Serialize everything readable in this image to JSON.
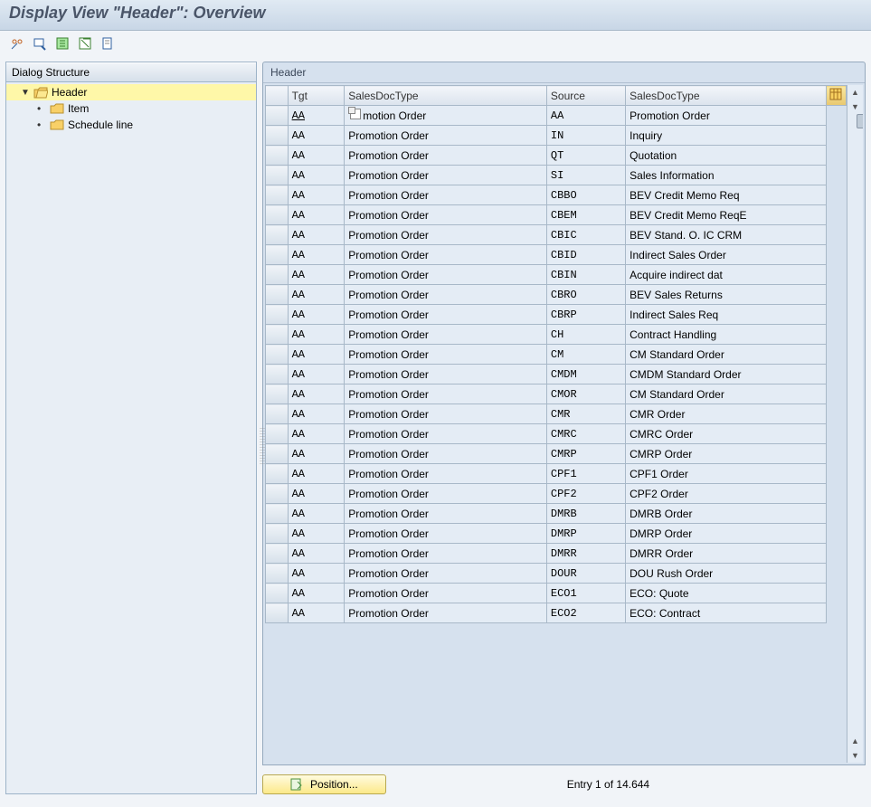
{
  "title": "Display View \"Header\": Overview",
  "toolbar_icons": [
    "glasses",
    "find",
    "table-nav",
    "table-export",
    "document"
  ],
  "tree": {
    "header": "Dialog Structure",
    "items": [
      {
        "label": "Header",
        "selected": true,
        "open": true,
        "level": 1,
        "expander": "▼"
      },
      {
        "label": "Item",
        "selected": false,
        "open": false,
        "level": 2,
        "expander": "•"
      },
      {
        "label": "Schedule line",
        "selected": false,
        "open": false,
        "level": 2,
        "expander": "•"
      }
    ]
  },
  "grid": {
    "title": "Header",
    "columns": [
      "Tgt",
      "SalesDocType",
      "Source",
      "SalesDocType"
    ],
    "rows": [
      {
        "tgt": "AA",
        "t1": "Promotion Order",
        "src": "AA",
        "t2": "Promotion Order",
        "f4": true
      },
      {
        "tgt": "AA",
        "t1": "Promotion Order",
        "src": "IN",
        "t2": "Inquiry"
      },
      {
        "tgt": "AA",
        "t1": "Promotion Order",
        "src": "QT",
        "t2": "Quotation"
      },
      {
        "tgt": "AA",
        "t1": "Promotion Order",
        "src": "SI",
        "t2": "Sales Information"
      },
      {
        "tgt": "AA",
        "t1": "Promotion Order",
        "src": "CBBO",
        "t2": "BEV Credit Memo Req"
      },
      {
        "tgt": "AA",
        "t1": "Promotion Order",
        "src": "CBEM",
        "t2": "BEV Credit Memo ReqE"
      },
      {
        "tgt": "AA",
        "t1": "Promotion Order",
        "src": "CBIC",
        "t2": "BEV Stand. O. IC CRM"
      },
      {
        "tgt": "AA",
        "t1": "Promotion Order",
        "src": "CBID",
        "t2": "Indirect Sales Order"
      },
      {
        "tgt": "AA",
        "t1": "Promotion Order",
        "src": "CBIN",
        "t2": "Acquire indirect dat"
      },
      {
        "tgt": "AA",
        "t1": "Promotion Order",
        "src": "CBRO",
        "t2": "BEV Sales Returns"
      },
      {
        "tgt": "AA",
        "t1": "Promotion Order",
        "src": "CBRP",
        "t2": "Indirect Sales Req"
      },
      {
        "tgt": "AA",
        "t1": "Promotion Order",
        "src": "CH",
        "t2": "Contract Handling"
      },
      {
        "tgt": "AA",
        "t1": "Promotion Order",
        "src": "CM",
        "t2": "CM Standard Order"
      },
      {
        "tgt": "AA",
        "t1": "Promotion Order",
        "src": "CMDM",
        "t2": "CMDM Standard Order"
      },
      {
        "tgt": "AA",
        "t1": "Promotion Order",
        "src": "CMOR",
        "t2": "CM Standard Order"
      },
      {
        "tgt": "AA",
        "t1": "Promotion Order",
        "src": "CMR",
        "t2": "CMR Order"
      },
      {
        "tgt": "AA",
        "t1": "Promotion Order",
        "src": "CMRC",
        "t2": "CMRC Order"
      },
      {
        "tgt": "AA",
        "t1": "Promotion Order",
        "src": "CMRP",
        "t2": "CMRP Order"
      },
      {
        "tgt": "AA",
        "t1": "Promotion Order",
        "src": "CPF1",
        "t2": "CPF1 Order"
      },
      {
        "tgt": "AA",
        "t1": "Promotion Order",
        "src": "CPF2",
        "t2": "CPF2 Order"
      },
      {
        "tgt": "AA",
        "t1": "Promotion Order",
        "src": "DMRB",
        "t2": "DMRB Order"
      },
      {
        "tgt": "AA",
        "t1": "Promotion Order",
        "src": "DMRP",
        "t2": "DMRP Order"
      },
      {
        "tgt": "AA",
        "t1": "Promotion Order",
        "src": "DMRR",
        "t2": "DMRR Order"
      },
      {
        "tgt": "AA",
        "t1": "Promotion Order",
        "src": "DOUR",
        "t2": "DOU Rush Order"
      },
      {
        "tgt": "AA",
        "t1": "Promotion Order",
        "src": "ECO1",
        "t2": "ECO: Quote"
      },
      {
        "tgt": "AA",
        "t1": "Promotion Order",
        "src": "ECO2",
        "t2": "ECO: Contract"
      }
    ]
  },
  "bottom": {
    "position_label": "Position...",
    "entry_label": "Entry 1 of 14.644"
  }
}
